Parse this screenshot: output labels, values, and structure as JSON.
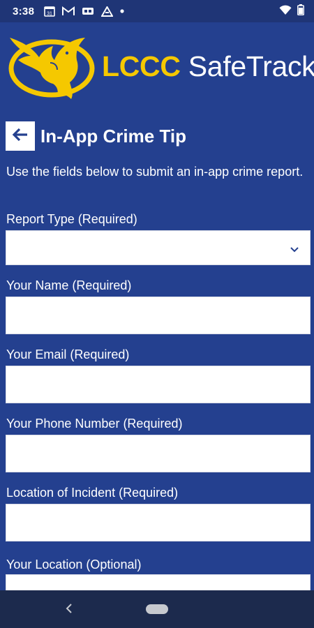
{
  "status_bar": {
    "time": "3:38",
    "icons": [
      "calendar-icon",
      "gmail-icon",
      "notification-box-icon",
      "drive-icon",
      "dot-icon",
      "wifi-icon",
      "battery-icon"
    ],
    "calendar_day": "31"
  },
  "header": {
    "brand_primary": "LCCC",
    "brand_secondary": "SafeTrack",
    "logo_icon": "eagle-logo-icon"
  },
  "page": {
    "title": "In-App Crime Tip",
    "intro": "Use the fields below to submit an in-app crime report."
  },
  "form": {
    "fields": [
      {
        "label": "Report Type (Required)",
        "value": "",
        "type": "select"
      },
      {
        "label": "Your Name (Required)",
        "value": "",
        "type": "text"
      },
      {
        "label": "Your Email (Required)",
        "value": "",
        "type": "text"
      },
      {
        "label": "Your Phone Number (Required)",
        "value": "",
        "type": "text"
      },
      {
        "label": "Location of Incident (Required)",
        "value": "",
        "type": "text"
      },
      {
        "label": "Your Location (Optional)",
        "value": "",
        "type": "text"
      }
    ]
  },
  "colors": {
    "background": "#24408f",
    "accent": "#f5c800",
    "status_bar": "#1f3576",
    "nav_bar": "#1c2a4d"
  }
}
